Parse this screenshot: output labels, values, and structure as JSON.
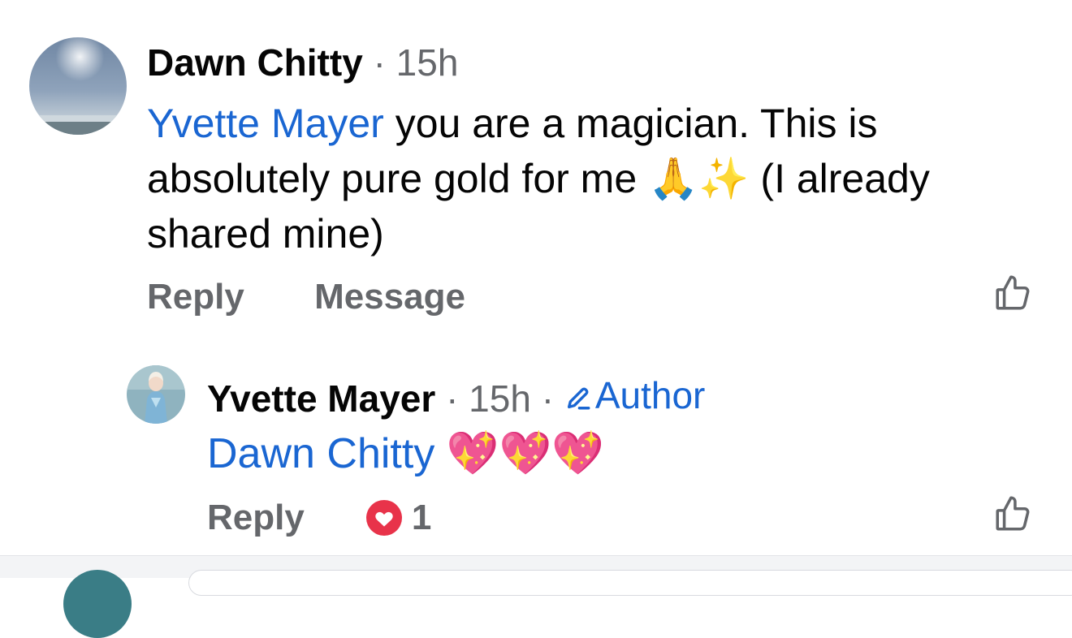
{
  "comment": {
    "author": "Dawn Chitty",
    "separator": "·",
    "time": "15h",
    "mention": "Yvette Mayer",
    "text": " you are a magician. This is absolutely pure gold for me 🙏✨ (I already shared mine)",
    "actions": {
      "reply": "Reply",
      "message": "Message"
    },
    "avatar_icon": "sky-photo-avatar",
    "like_icon": "thumbs-up-icon"
  },
  "reply": {
    "author": "Yvette Mayer",
    "separator": "·",
    "time": "15h",
    "separator2": "·",
    "badge": "Author",
    "badge_icon": "pencil-icon",
    "mention": "Dawn Chitty",
    "text": " 💖💖💖",
    "actions": {
      "reply": "Reply"
    },
    "reaction": {
      "icon": "love-reaction-icon",
      "count": "1"
    },
    "avatar_icon": "profile-photo-avatar",
    "like_icon": "thumbs-up-icon"
  },
  "colors": {
    "mention": "#1a66d2",
    "secondary_text": "#65676b",
    "love_reaction": "#e8334a"
  }
}
